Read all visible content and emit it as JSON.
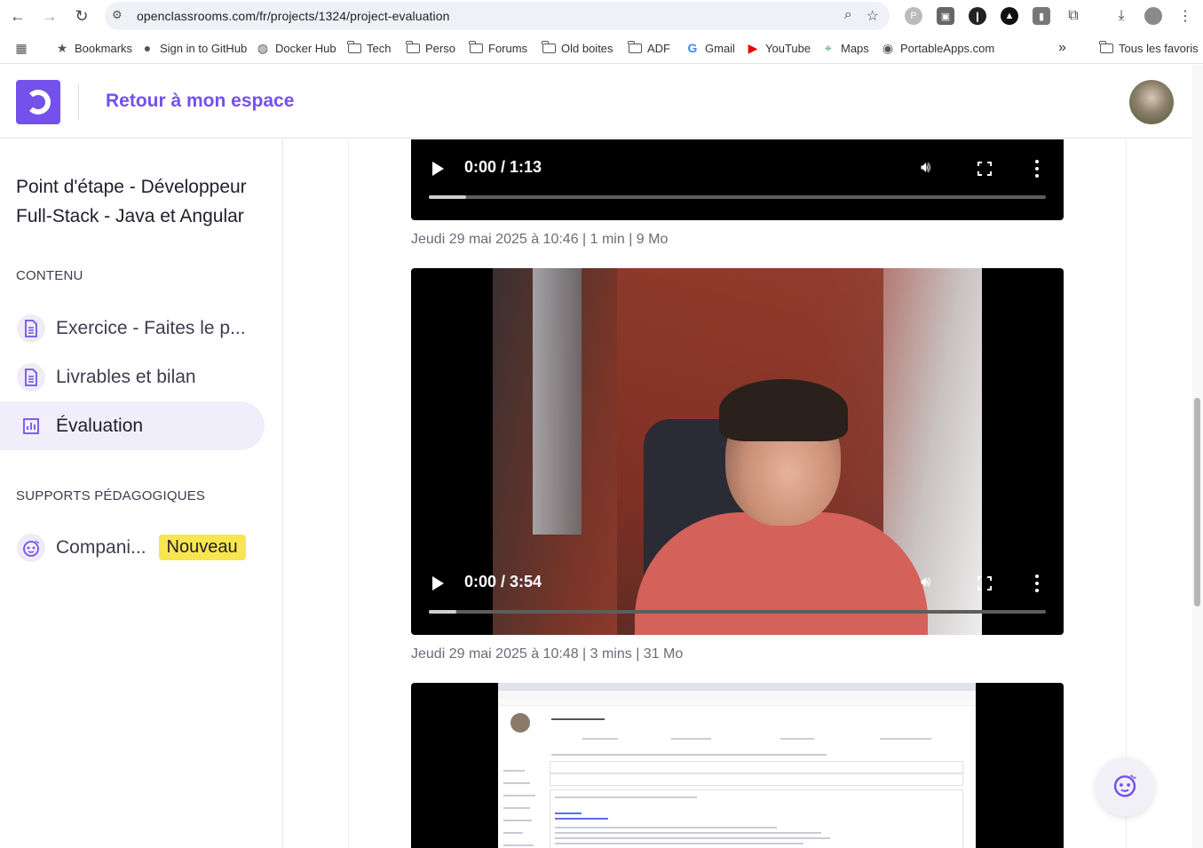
{
  "browser": {
    "url": "openclassrooms.com/fr/projects/1324/project-evaluation",
    "bookmarks": [
      {
        "label": "Bookmarks",
        "icon": "star-icon"
      },
      {
        "label": "Sign in to GitHub",
        "icon": "github-icon"
      },
      {
        "label": "Docker Hub",
        "icon": "docker-icon"
      },
      {
        "label": "Tech",
        "icon": "folder-icon"
      },
      {
        "label": "Perso",
        "icon": "folder-icon"
      },
      {
        "label": "Forums",
        "icon": "folder-icon"
      },
      {
        "label": "Old boites",
        "icon": "folder-icon"
      },
      {
        "label": "ADF",
        "icon": "folder-icon"
      },
      {
        "label": "Gmail",
        "icon": "google-icon"
      },
      {
        "label": "YouTube",
        "icon": "youtube-icon"
      },
      {
        "label": "Maps",
        "icon": "maps-icon"
      },
      {
        "label": "PortableApps.com",
        "icon": "portableapps-icon"
      }
    ],
    "all_bookmarks_label": "Tous les favoris",
    "more_label": "»"
  },
  "header": {
    "back_label": "Retour à mon espace"
  },
  "sidebar": {
    "course_title": "Point d'étape - Développeur Full-Stack - Java et Angular",
    "content_label": "CONTENU",
    "items": [
      {
        "label": "Exercice - Faites le p...",
        "icon": "document-icon",
        "active": false
      },
      {
        "label": "Livrables et bilan",
        "icon": "document-icon",
        "active": false
      },
      {
        "label": "Évaluation",
        "icon": "chart-icon",
        "active": true
      }
    ],
    "supports_label": "SUPPORTS PÉDAGOGIQUES",
    "companion": {
      "label": "Compani...",
      "badge": "Nouveau",
      "icon": "robot-icon"
    }
  },
  "videos": [
    {
      "time": "0:00 / 1:13",
      "progress": 0.06,
      "meta": "Jeudi 29 mai 2025 à 10:46 | 1 min | 9 Mo"
    },
    {
      "time": "0:00 / 3:54",
      "progress": 0.045,
      "meta": "Jeudi 29 mai 2025 à 10:48 | 3 mins | 31 Mo"
    },
    {
      "time": "",
      "progress": 0
    }
  ],
  "colors": {
    "brand": "#7451eb",
    "badge": "#f7e64f",
    "active_bg": "#f0eefa"
  }
}
